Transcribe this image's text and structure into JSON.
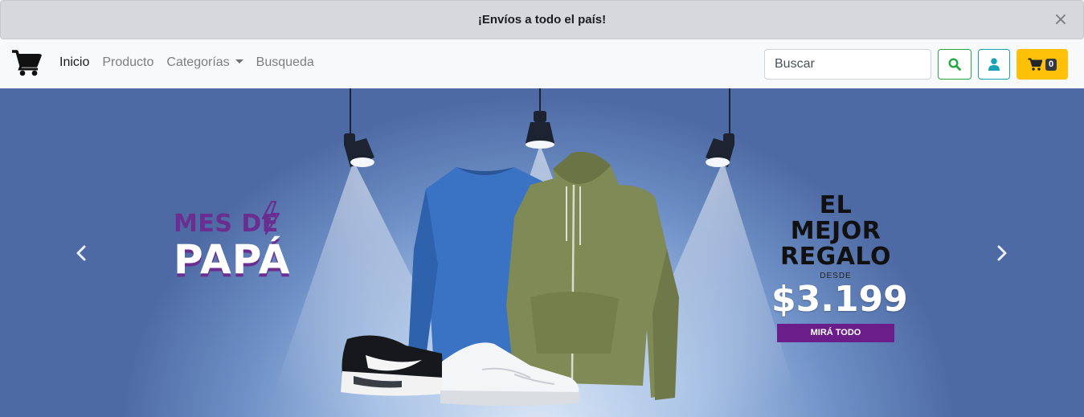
{
  "announcement": {
    "text": "¡Envíos a todo el país!",
    "close_label": "×"
  },
  "navbar": {
    "brand_icon": "cart-icon",
    "links": [
      {
        "label": "Inicio",
        "active": true
      },
      {
        "label": "Producto",
        "active": false
      },
      {
        "label": "Categorías",
        "active": false,
        "dropdown": true
      },
      {
        "label": "Busqueda",
        "active": false
      }
    ],
    "search": {
      "placeholder": "Buscar",
      "value": ""
    },
    "buttons": {
      "search_icon": "search-icon",
      "user_icon": "user-icon",
      "cart_icon": "cart-icon",
      "cart_count": "0"
    }
  },
  "hero": {
    "left": {
      "line1": "MES DE",
      "line2": "PAPÁ"
    },
    "right": {
      "heading1": "EL MEJOR",
      "heading2": "REGALO",
      "prefix": "DESDE",
      "price": "$3.199",
      "cta": "MIRÁ TODO"
    },
    "controls": {
      "prev_icon": "chevron-left-icon",
      "next_icon": "chevron-right-icon"
    }
  },
  "colors": {
    "announcement_bg": "#d6d8db",
    "navbar_bg": "#f8f9fa",
    "search_button": "#28a745",
    "user_button": "#17a2b8",
    "cart_button": "#ffc107",
    "promo_purple": "#6b2d8f"
  }
}
